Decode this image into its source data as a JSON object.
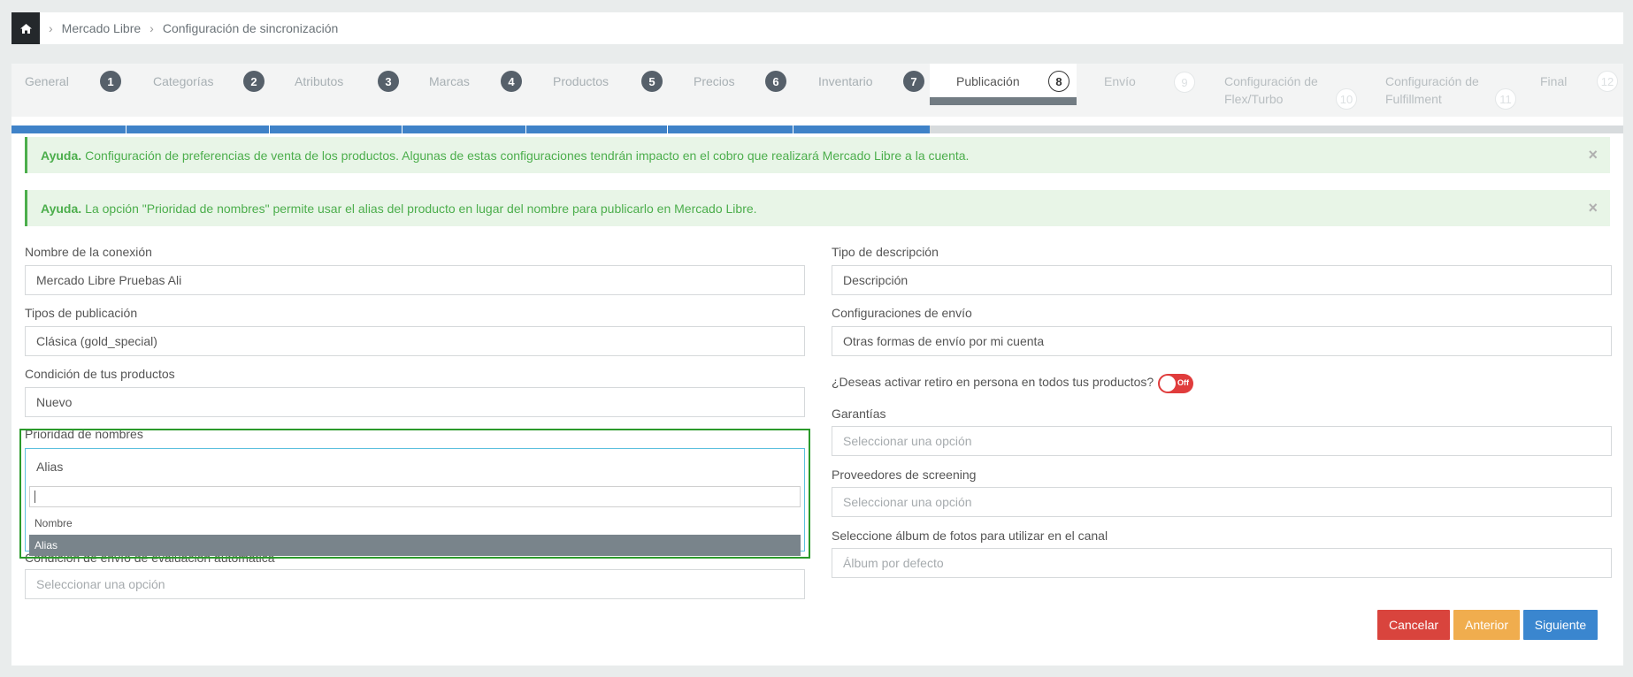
{
  "breadcrumb": {
    "items": [
      "Mercado Libre",
      "Configuración de sincronización"
    ]
  },
  "steps": [
    {
      "label": "General",
      "num": "1",
      "state": "done"
    },
    {
      "label": "Categorías",
      "num": "2",
      "state": "done"
    },
    {
      "label": "Atributos",
      "num": "3",
      "state": "done"
    },
    {
      "label": "Marcas",
      "num": "4",
      "state": "done"
    },
    {
      "label": "Productos",
      "num": "5",
      "state": "done"
    },
    {
      "label": "Precios",
      "num": "6",
      "state": "done"
    },
    {
      "label": "Inventario",
      "num": "7",
      "state": "done"
    },
    {
      "label": "Publicación",
      "num": "8",
      "state": "active"
    },
    {
      "label": "Envío",
      "num": "9",
      "state": "todo"
    },
    {
      "label": "Configuración de Flex/Turbo",
      "num": "10",
      "state": "todo"
    },
    {
      "label": "Configuración de Fulfillment",
      "num": "11",
      "state": "todo"
    },
    {
      "label": "Final",
      "num": "12",
      "state": "todo"
    }
  ],
  "alerts": [
    {
      "prefix": "Ayuda.",
      "text": "Configuración de preferencias de venta de los productos. Algunas de estas configuraciones tendrán impacto en el cobro que realizará Mercado Libre a la cuenta.",
      "close": "×"
    },
    {
      "prefix": "Ayuda.",
      "text": "La opción \"Prioridad de nombres\" permite usar el alias del producto en lugar del nombre para publicarlo en Mercado Libre.",
      "close": "×"
    }
  ],
  "form": {
    "connection_name": {
      "label": "Nombre de la conexión",
      "value": "Mercado Libre Pruebas Ali"
    },
    "publication_types": {
      "label": "Tipos de publicación",
      "value": "Clásica (gold_special)"
    },
    "product_condition": {
      "label": "Condición de tus productos",
      "value": "Nuevo"
    },
    "name_priority": {
      "label": "Prioridad de nombres",
      "value": "Alias",
      "search": "",
      "options": [
        "Nombre",
        "Alias"
      ],
      "selected": "Alias"
    },
    "auto_eval_condition": {
      "label": "Condición de envío de evaluación automática",
      "placeholder": "Seleccionar una opción"
    },
    "description_type": {
      "label": "Tipo de descripción",
      "value": "Descripción"
    },
    "shipping_config": {
      "label": "Configuraciones de envío",
      "value": "Otras formas de envío por mi cuenta"
    },
    "pickup_toggle": {
      "label": "¿Deseas activar retiro en persona en todos tus productos?",
      "state": "Off"
    },
    "warranties": {
      "label": "Garantías",
      "placeholder": "Seleccionar una opción"
    },
    "screening": {
      "label": "Proveedores de screening",
      "placeholder": "Seleccionar una opción"
    },
    "album": {
      "label": "Seleccione álbum de fotos para utilizar en el canal",
      "placeholder": "Álbum por defecto"
    }
  },
  "buttons": {
    "cancel": "Cancelar",
    "previous": "Anterior",
    "next": "Siguiente"
  },
  "colors": {
    "primary": "#3a86cf",
    "danger": "#d9443d",
    "warning": "#f0ad4e",
    "success": "#4cae4c"
  }
}
